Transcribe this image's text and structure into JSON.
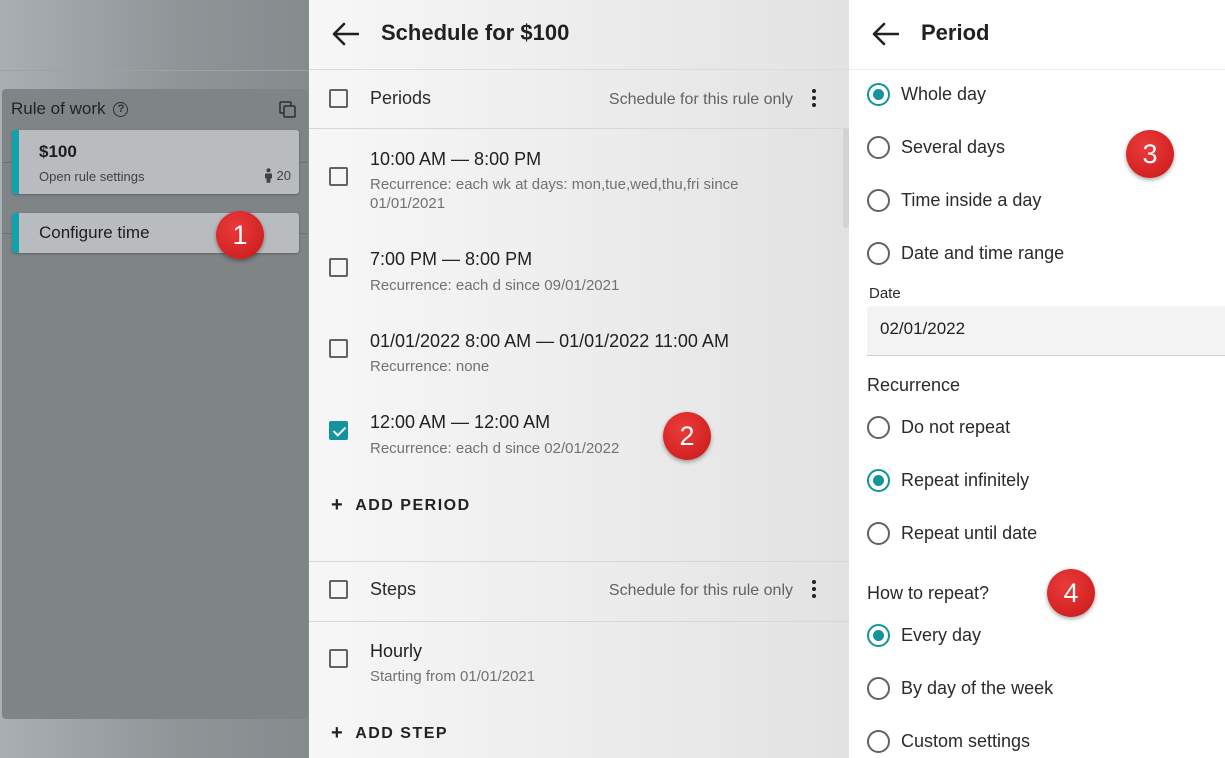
{
  "left": {
    "rule_title": "Rule of work",
    "items": [
      {
        "name": "$100",
        "sub": "Open rule settings",
        "count": "20"
      },
      {
        "name": "Configure time"
      }
    ]
  },
  "schedule": {
    "title": "Schedule for $100",
    "periods_section": {
      "label": "Periods",
      "note": "Schedule for this rule only"
    },
    "periods": [
      {
        "title": "10:00 AM — 8:00 PM",
        "recurrence": "Recurrence: each wk at days: mon,tue,wed,thu,fri since 01/01/2021",
        "checked": false
      },
      {
        "title": "7:00 PM — 8:00 PM",
        "recurrence": "Recurrence: each d since 09/01/2021",
        "checked": false
      },
      {
        "title": "01/01/2022 8:00 AM — 01/01/2022 11:00 AM",
        "recurrence": "Recurrence: none",
        "checked": false
      },
      {
        "title": "12:00 AM — 12:00 AM",
        "recurrence": "Recurrence: each d since 02/01/2022",
        "checked": true
      }
    ],
    "add_period": "ADD PERIOD",
    "steps_section": {
      "label": "Steps",
      "note": "Schedule for this rule only"
    },
    "steps": [
      {
        "title": "Hourly",
        "sub": "Starting from 01/01/2021",
        "checked": false
      }
    ],
    "add_step": "ADD STEP"
  },
  "period": {
    "title": "Period",
    "type_options": [
      {
        "label": "Whole day",
        "selected": true
      },
      {
        "label": "Several days",
        "selected": false
      },
      {
        "label": "Time inside a day",
        "selected": false
      },
      {
        "label": "Date and time range",
        "selected": false
      }
    ],
    "date_label": "Date",
    "date_value": "02/01/2022",
    "recurrence_heading": "Recurrence",
    "recurrence_options": [
      {
        "label": "Do not repeat",
        "selected": false
      },
      {
        "label": "Repeat infinitely",
        "selected": true
      },
      {
        "label": "Repeat until date",
        "selected": false
      }
    ],
    "how_heading": "How to repeat?",
    "how_options": [
      {
        "label": "Every day",
        "selected": true
      },
      {
        "label": "By day of the week",
        "selected": false
      },
      {
        "label": "Custom settings",
        "selected": false
      }
    ]
  },
  "badges": [
    "1",
    "2",
    "3",
    "4"
  ],
  "colors": {
    "accent": "#12939d",
    "badge": "#d32222"
  },
  "icons": [
    "help-icon",
    "copy-icon",
    "person-icon",
    "back-arrow-icon",
    "more-vert-icon",
    "plus-icon"
  ]
}
